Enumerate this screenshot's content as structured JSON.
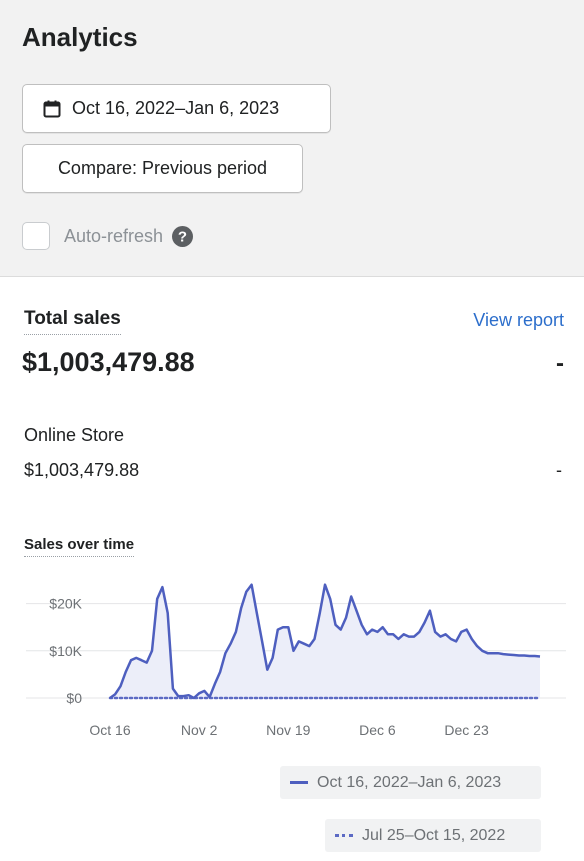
{
  "header": {
    "title": "Analytics",
    "date_range": "Oct 16, 2022–Jan 6, 2023",
    "compare": "Compare: Previous period",
    "auto_refresh": {
      "label": "Auto-refresh",
      "checked": false
    }
  },
  "icons": {
    "calendar": "calendar-icon",
    "help": "question-circle-icon"
  },
  "metric": {
    "title": "Total sales",
    "view_report": "View report",
    "value": "$1,003,479.88",
    "delta": "-",
    "channels": [
      {
        "name": "Online Store",
        "value": "$1,003,479.88",
        "delta": "-"
      }
    ]
  },
  "chart_title": "Sales over time",
  "colors": {
    "current": "#4e5fbf",
    "previous": "#5c6ac4",
    "link": "#2c6ecb",
    "gridline": "#e4e5e7"
  },
  "chart_data": {
    "type": "line",
    "title": "Sales over time",
    "x_tick_labels": [
      "Oct 16",
      "Nov 2",
      "Nov 19",
      "Dec 6",
      "Dec 23"
    ],
    "y_tick_labels": [
      "$20K",
      "$10K",
      "$0"
    ],
    "ylim": [
      0,
      25000
    ],
    "y_ticks": [
      20000,
      10000,
      0
    ],
    "x_ticks_day": [
      0,
      17,
      34,
      51,
      68
    ],
    "xlim_day": [
      0,
      82
    ],
    "grid": true,
    "legend_position": "bottom-right",
    "series": [
      {
        "name": "Oct 16, 2022–Jan 6, 2023",
        "style": "solid",
        "day": [
          0,
          1,
          2,
          3,
          4,
          5,
          6,
          7,
          8,
          9,
          10,
          11,
          12,
          13,
          14,
          15,
          16,
          17,
          18,
          19,
          20,
          21,
          22,
          23,
          24,
          25,
          26,
          27,
          28,
          29,
          30,
          31,
          32,
          33,
          34,
          35,
          36,
          37,
          38,
          39,
          40,
          41,
          42,
          43,
          44,
          45,
          46,
          47,
          48,
          49,
          50,
          51,
          52,
          53,
          54,
          55,
          56,
          57,
          58,
          59,
          60,
          61,
          62,
          63,
          64,
          65,
          66,
          67,
          68,
          69,
          70,
          71,
          72,
          73,
          74,
          75,
          76,
          77,
          78,
          79,
          80,
          81,
          82
        ],
        "values": [
          0,
          800,
          2500,
          5500,
          8000,
          8500,
          8000,
          7500,
          10000,
          21000,
          23500,
          18000,
          2000,
          400,
          400,
          600,
          0,
          1000,
          1500,
          200,
          3000,
          5500,
          9500,
          11500,
          14000,
          19000,
          22500,
          24000,
          18000,
          12000,
          6000,
          8500,
          14500,
          15000,
          15000,
          10000,
          12000,
          11500,
          11000,
          12500,
          18000,
          24000,
          21000,
          15500,
          14500,
          17000,
          21500,
          18500,
          15500,
          13500,
          14500,
          14000,
          15000,
          13500,
          13500,
          12500,
          13500,
          13000,
          13000,
          14000,
          16000,
          18500,
          14000,
          13000,
          13500,
          12500,
          12000,
          14000,
          14500,
          12500,
          11000,
          10000,
          9500,
          9500,
          9500,
          9300,
          9200,
          9100,
          9000,
          9000,
          8900,
          8900,
          8800
        ]
      },
      {
        "name": "Jul 25–Oct 15, 2022",
        "style": "dotted",
        "day": [
          0,
          82
        ],
        "values": [
          0,
          0
        ]
      }
    ]
  }
}
